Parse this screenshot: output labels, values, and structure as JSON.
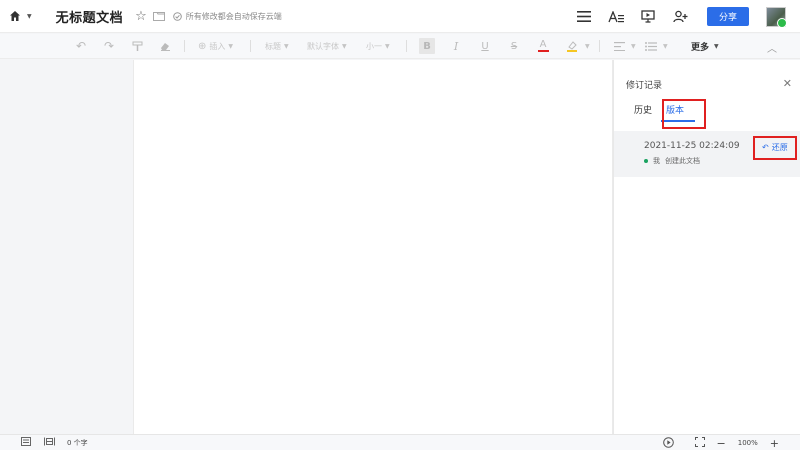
{
  "header": {
    "doc_title": "无标题文档",
    "save_status": "所有修改都会自动保存云端",
    "share_label": "分享",
    "icons": [
      "home-icon",
      "star-icon",
      "folder-icon",
      "menu-icon",
      "text-style-icon",
      "present-icon",
      "add-user-icon"
    ]
  },
  "toolbar": {
    "insert_label": "插入",
    "heading_label": "标题",
    "font_label": "默认字体",
    "size_label": "小一",
    "more_label": "更多"
  },
  "panel": {
    "title": "修订记录",
    "tabs": [
      "历史",
      "版本"
    ],
    "active_tab": "版本",
    "version": {
      "time": "2021-11-25 02:24:09",
      "author": "我",
      "action": "创建此文档",
      "restore_label": "还原"
    }
  },
  "statusbar": {
    "word_count": "0 个字",
    "zoom": "100%"
  },
  "colors": {
    "accent": "#2b6de8",
    "highlight": "#e02020"
  }
}
